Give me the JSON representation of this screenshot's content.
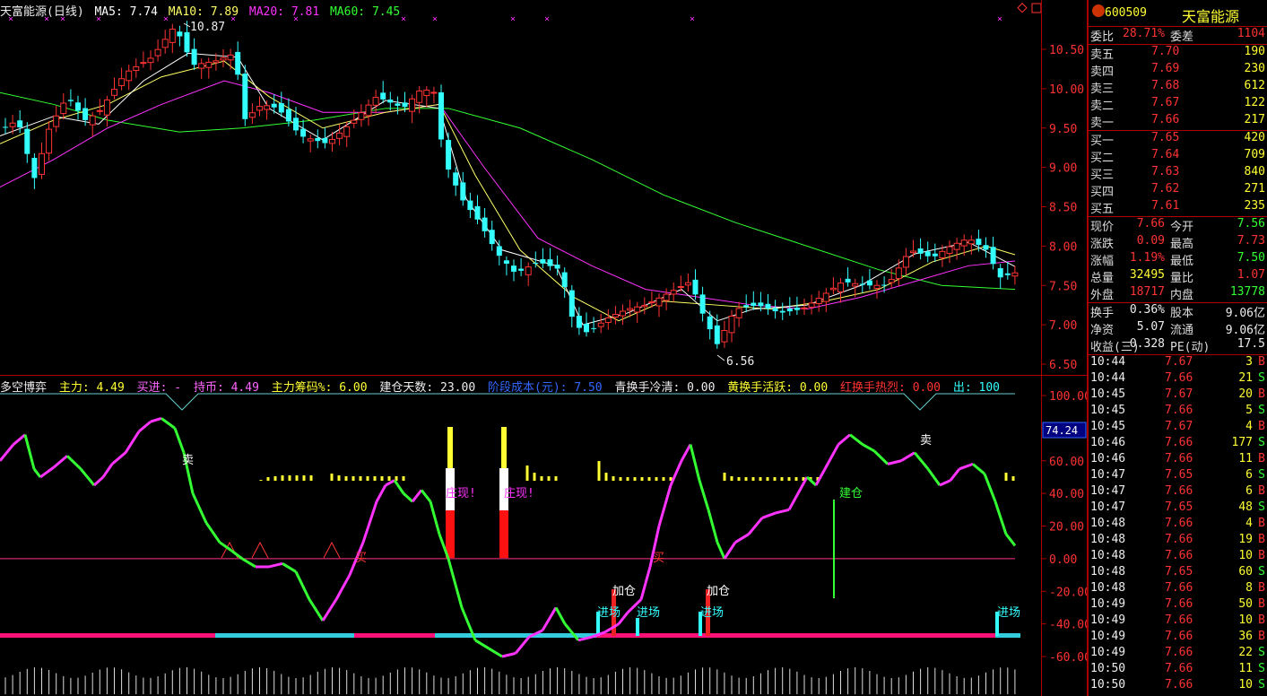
{
  "price_header": {
    "title": "天富能源(日线)",
    "ma5": "MA5: 7.74",
    "ma10": "MA10: 7.89",
    "ma20": "MA20: 7.81",
    "ma60": "MA60: 7.45"
  },
  "price_axis": [
    "10.50",
    "10.00",
    "9.50",
    "9.00",
    "8.50",
    "8.00",
    "7.50",
    "7.00",
    "6.50"
  ],
  "price_annotations": {
    "high": "10.87",
    "low": "6.56"
  },
  "indicator_header": {
    "name": "多空博弈",
    "zhuli": "主力: 4.49",
    "maijin": "买进: -",
    "chibi": "持币: 4.49",
    "chouma": "主力筹码%: 6.00",
    "jiancang_days": "建仓天数: 23.00",
    "cost": "阶段成本(元): 7.50",
    "qing": "青换手冷清: 0.00",
    "huang": "黄换手活跃: 0.00",
    "hong": "红换手热烈: 0.00",
    "chu": "出: 100"
  },
  "indicator_axis": [
    "100.00",
    "80.00",
    "60.00",
    "40.00",
    "20.00",
    "0.00",
    "-20.00",
    "-40.00",
    "-60.00"
  ],
  "indicator_current": "74.24",
  "indicator_labels": {
    "sell": "卖",
    "buy": "买",
    "zhuang": "庄现!",
    "jiacang": "加仓",
    "jinchang": "进场",
    "jiancang": "建仓"
  },
  "quote": {
    "code": "600509",
    "name": "天富能源",
    "weibi_label": "委比",
    "weibi": "28.71%",
    "weicha_label": "委差",
    "weicha": "1104",
    "asks": [
      {
        "label": "卖五",
        "price": "7.70",
        "vol": "190"
      },
      {
        "label": "卖四",
        "price": "7.69",
        "vol": "230"
      },
      {
        "label": "卖三",
        "price": "7.68",
        "vol": "612"
      },
      {
        "label": "卖二",
        "price": "7.67",
        "vol": "122"
      },
      {
        "label": "卖一",
        "price": "7.66",
        "vol": "217"
      }
    ],
    "bids": [
      {
        "label": "买一",
        "price": "7.65",
        "vol": "420"
      },
      {
        "label": "买二",
        "price": "7.64",
        "vol": "709"
      },
      {
        "label": "买三",
        "price": "7.63",
        "vol": "840"
      },
      {
        "label": "买四",
        "price": "7.62",
        "vol": "271"
      },
      {
        "label": "买五",
        "price": "7.61",
        "vol": "235"
      }
    ],
    "stats1": [
      {
        "l1": "现价",
        "v1": "7.66",
        "c1": "red",
        "l2": "今开",
        "v2": "7.56",
        "c2": "green"
      },
      {
        "l1": "涨跌",
        "v1": "0.09",
        "c1": "red",
        "l2": "最高",
        "v2": "7.73",
        "c2": "red"
      },
      {
        "l1": "涨幅",
        "v1": "1.19%",
        "c1": "red",
        "l2": "最低",
        "v2": "7.50",
        "c2": "green"
      },
      {
        "l1": "总量",
        "v1": "32495",
        "c1": "yellow",
        "l2": "量比",
        "v2": "1.07",
        "c2": "red"
      },
      {
        "l1": "外盘",
        "v1": "18717",
        "c1": "red",
        "l2": "内盘",
        "v2": "13778",
        "c2": "green"
      }
    ],
    "stats2": [
      {
        "l1": "换手",
        "v1": "0.36%",
        "c1": "white",
        "l2": "股本",
        "v2": "9.06亿",
        "c2": "white"
      },
      {
        "l1": "净资",
        "v1": "5.07",
        "c1": "white",
        "l2": "流通",
        "v2": "9.06亿",
        "c2": "white"
      },
      {
        "l1": "收益(三)",
        "v1": "0.328",
        "c1": "white",
        "l2": "PE(动)",
        "v2": "17.5",
        "c2": "white"
      }
    ],
    "ticks": [
      {
        "t": "10:44",
        "p": "7.67",
        "pc": "red",
        "v": "3",
        "s": "B"
      },
      {
        "t": "10:44",
        "p": "7.66",
        "pc": "red",
        "v": "21",
        "s": "S"
      },
      {
        "t": "10:45",
        "p": "7.67",
        "pc": "red",
        "v": "20",
        "s": "B"
      },
      {
        "t": "10:45",
        "p": "7.66",
        "pc": "red",
        "v": "5",
        "s": "S"
      },
      {
        "t": "10:45",
        "p": "7.67",
        "pc": "red",
        "v": "4",
        "s": "B"
      },
      {
        "t": "10:46",
        "p": "7.66",
        "pc": "red",
        "v": "177",
        "s": "S"
      },
      {
        "t": "10:46",
        "p": "7.66",
        "pc": "red",
        "v": "11",
        "s": "B"
      },
      {
        "t": "10:47",
        "p": "7.65",
        "pc": "red",
        "v": "6",
        "s": "S"
      },
      {
        "t": "10:47",
        "p": "7.66",
        "pc": "red",
        "v": "6",
        "s": "B"
      },
      {
        "t": "10:47",
        "p": "7.65",
        "pc": "red",
        "v": "48",
        "s": "S"
      },
      {
        "t": "10:48",
        "p": "7.66",
        "pc": "red",
        "v": "4",
        "s": "B"
      },
      {
        "t": "10:48",
        "p": "7.66",
        "pc": "red",
        "v": "19",
        "s": "B"
      },
      {
        "t": "10:48",
        "p": "7.66",
        "pc": "red",
        "v": "10",
        "s": "B"
      },
      {
        "t": "10:48",
        "p": "7.65",
        "pc": "red",
        "v": "60",
        "s": "S"
      },
      {
        "t": "10:48",
        "p": "7.66",
        "pc": "red",
        "v": "8",
        "s": "B"
      },
      {
        "t": "10:49",
        "p": "7.66",
        "pc": "red",
        "v": "50",
        "s": "B"
      },
      {
        "t": "10:49",
        "p": "7.66",
        "pc": "red",
        "v": "10",
        "s": "B"
      },
      {
        "t": "10:49",
        "p": "7.66",
        "pc": "red",
        "v": "36",
        "s": "B"
      },
      {
        "t": "10:49",
        "p": "7.66",
        "pc": "red",
        "v": "22",
        "s": "S"
      },
      {
        "t": "10:50",
        "p": "7.66",
        "pc": "red",
        "v": "11",
        "s": "S"
      },
      {
        "t": "10:50",
        "p": "7.66",
        "pc": "red",
        "v": "10",
        "s": "S"
      }
    ]
  },
  "colors": {
    "up": "#ff3333",
    "down": "#33ffff",
    "ma5": "#ffffff",
    "ma10": "#ffff66",
    "ma20": "#ff33ff",
    "ma60": "#33ff33",
    "grid": "#aa0000"
  }
}
